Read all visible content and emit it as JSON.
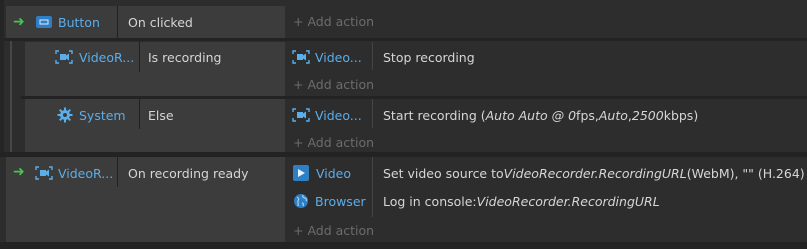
{
  "events": [
    {
      "object": "Button",
      "object_icon": "button-icon",
      "condition": "On clicked",
      "add_action": "+ Add action",
      "subevents": [
        {
          "object": "VideoR...",
          "object_icon": "video-recorder-icon",
          "condition": "Is recording",
          "actions": [
            {
              "object": "Video...",
              "object_icon": "video-recorder-icon",
              "text": "Stop recording"
            }
          ],
          "add_action": "+ Add action"
        },
        {
          "object": "System",
          "object_icon": "gear-icon",
          "condition": "Else",
          "actions": [
            {
              "object": "Video...",
              "object_icon": "video-recorder-icon",
              "text_pre": "Start recording (",
              "text_italic1": "Auto Auto @ 0",
              "text_mid1": " fps, ",
              "text_italic2": "Auto",
              "text_mid2": ", ",
              "text_italic3": "2500",
              "text_post": " kbps)"
            }
          ],
          "add_action": "+ Add action"
        }
      ]
    },
    {
      "object": "VideoR...",
      "object_icon": "video-recorder-icon",
      "condition": "On recording ready",
      "actions": [
        {
          "object": "Video",
          "object_icon": "video-icon",
          "text_pre": "Set video source to ",
          "text_italic1": "VideoRecorder.RecordingURL",
          "text_mid1": " (WebM), \"\" (H.264)"
        },
        {
          "object": "Browser",
          "object_icon": "globe-icon",
          "text_pre": "Log in console: ",
          "text_italic1": "VideoRecorder.RecordingURL"
        }
      ],
      "add_action": "+ Add action"
    }
  ],
  "colors": {
    "background": "#2d2d2d",
    "condition_bg": "#3c3c3c",
    "object_blue": "#5aaeea",
    "trigger_green": "#4ec04e",
    "muted_text": "#6c6c6c"
  }
}
